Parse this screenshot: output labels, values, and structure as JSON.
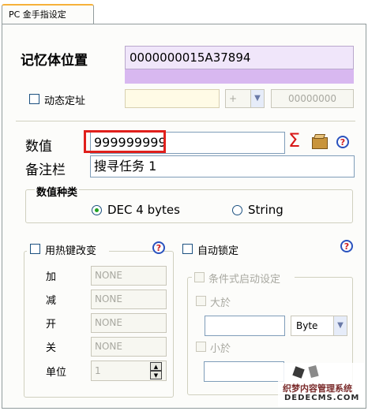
{
  "tab": {
    "label": "PC 金手指设定"
  },
  "memory": {
    "label": "记忆体位置",
    "address": "0000000015A37894"
  },
  "dynamic": {
    "label": "动态定址",
    "operator": "+",
    "offset": "00000000"
  },
  "value": {
    "label": "数值",
    "input": "999999999"
  },
  "note": {
    "label": "备注栏",
    "input": "搜寻任务 1"
  },
  "value_type": {
    "title": "数值种类",
    "options": [
      "DEC 4 bytes",
      "String"
    ],
    "selected": "DEC 4 bytes"
  },
  "hotkey": {
    "label": "用热键改变",
    "rows": [
      {
        "label": "加",
        "value": "NONE"
      },
      {
        "label": "减",
        "value": "NONE"
      },
      {
        "label": "开",
        "value": "NONE"
      },
      {
        "label": "关",
        "value": "NONE"
      }
    ],
    "unit_label": "单位",
    "unit_value": "1"
  },
  "autolock": {
    "label": "自动锁定",
    "conditional": "条件式启动设定",
    "greater": "大於",
    "less": "小於",
    "type": "Byte"
  },
  "watermark": {
    "line1": "织梦内容管理系统",
    "line2": "DEDECMS.COM"
  },
  "colors": {
    "accent": "#f6b13a",
    "highlight_box": "#e0201c",
    "address_bg": "#f0e6fa",
    "address_bar": "#d8b8f0"
  }
}
